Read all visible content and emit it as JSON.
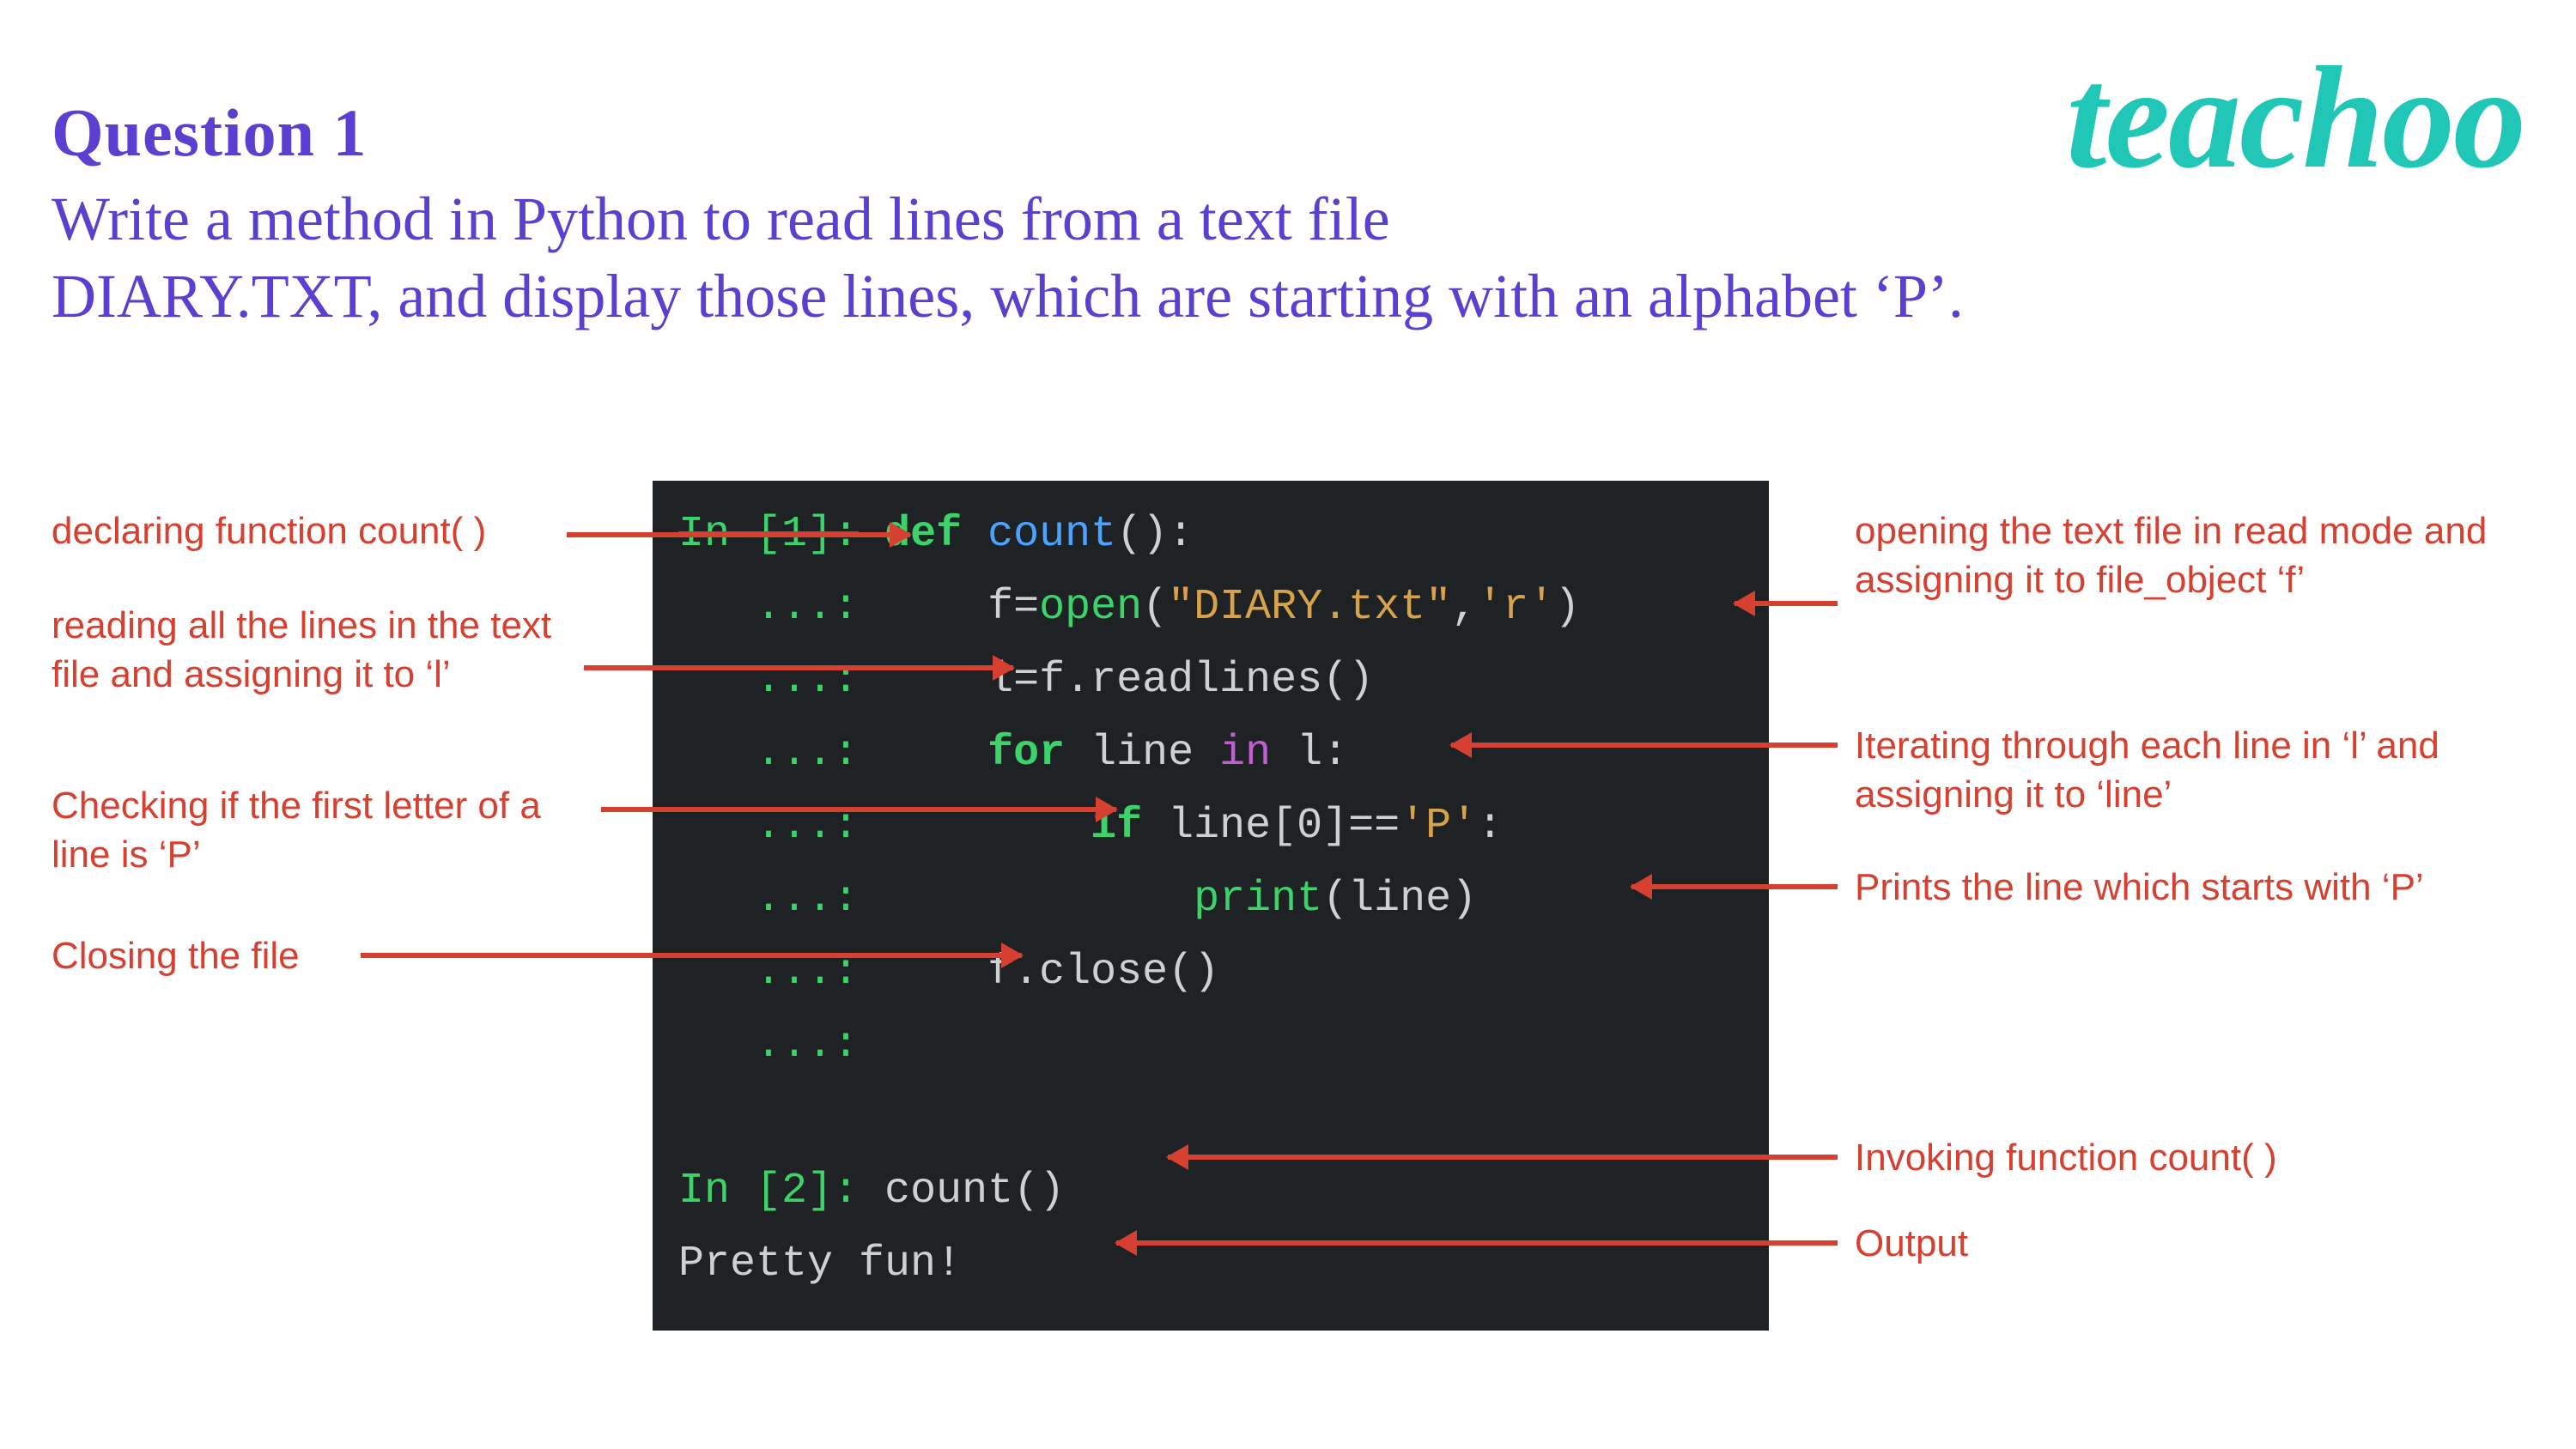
{
  "brand": "teachoo",
  "question": {
    "title": "Question 1",
    "body_line1": "Write a method in Python to read lines from a text  file",
    "body_line2": "DIARY.TXT, and display those lines, which  are starting with an alphabet ‘P’."
  },
  "code": {
    "p1": "In [1]:",
    "kw_def": "def",
    "fn_count": "count",
    "paren_colon": "():",
    "dots": "   ...:",
    "assign_f": "f=",
    "open_call": "open",
    "open_args_l": "(",
    "str_diary": "\"DIARY.txt\"",
    "comma": ",",
    "str_mode": "'r'",
    "open_args_r": ")",
    "assign_l": "l=f.readlines()",
    "kw_for": "for",
    "for_mid": " line ",
    "kw_in": "in",
    "for_end": " l:",
    "kw_if": "if",
    "if_tail": " line[0]==",
    "str_p": "'P'",
    "if_colon": ":",
    "print_call": "print",
    "print_args": "(line)",
    "close_call": "f.close()",
    "p2": "In [2]:",
    "invoke": "count()",
    "output": "Pretty fun!"
  },
  "annotations": {
    "left": {
      "declare": "declaring function count( )",
      "readlines": "reading all the lines in the text file and assigning it to ‘l’",
      "check": "Checking if the first letter of a line is ‘P’",
      "close": "Closing the file"
    },
    "right": {
      "open": "opening the text file in read mode and assigning it to file_object ‘f’",
      "iterate": "Iterating through each line in ‘l’ and assigning it to ‘line’",
      "print": "Prints the line which starts with ‘P’",
      "invoke": "Invoking function count( )",
      "output": "Output"
    }
  }
}
